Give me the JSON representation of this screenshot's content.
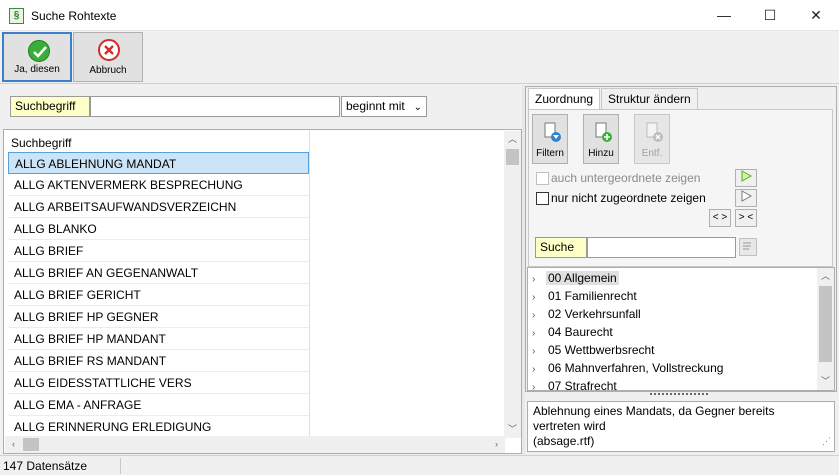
{
  "window": {
    "title": "Suche Rohtexte",
    "icon_glyph": "§",
    "min": "—",
    "max": "☐",
    "close": "✕"
  },
  "toolbar": {
    "ok_label": "Ja, diesen",
    "cancel_label": "Abbruch",
    "ok_color": "#2e9e2e",
    "cancel_color": "#d42a2a"
  },
  "search": {
    "label": "Suchbegriff",
    "value": "",
    "mode": "beginnt mit"
  },
  "list": {
    "header": "Suchbegriff",
    "rows": [
      "ALLG ABLEHNUNG MANDAT",
      "ALLG AKTENVERMERK BESPRECHUNG",
      "ALLG ARBEITSAUFWANDSVERZEICHN",
      "ALLG BLANKO",
      "ALLG BRIEF",
      "ALLG BRIEF AN GEGENANWALT",
      "ALLG BRIEF GERICHT",
      "ALLG BRIEF HP GEGNER",
      "ALLG BRIEF HP MANDANT",
      "ALLG BRIEF RS MANDANT",
      "ALLG EIDESSTATTLICHE VERS",
      "ALLG EMA - ANFRAGE",
      "ALLG ERINNERUNG ERLEDIGUNG"
    ],
    "selected_index": 0
  },
  "tabs": [
    {
      "label": "Zuordnung"
    },
    {
      "label": "Struktur ändern"
    }
  ],
  "assign": {
    "filter_label": "Filtern",
    "add_label": "Hinzu",
    "remove_label": "Entf.",
    "chk_sub": "auch untergeordnete zeigen",
    "chk_unassigned": "nur nicht zugeordnete zeigen",
    "btn_expand": "< >",
    "btn_collapse": "> <",
    "search_label": "Suche",
    "search_value": ""
  },
  "tree": {
    "items": [
      "00 Allgemein",
      "01 Familienrecht",
      "02 Verkehrsunfall",
      "04 Baurecht",
      "05 Wettbwerbsrecht",
      "06 Mahnverfahren, Vollstreckung",
      "07 Strafrecht"
    ],
    "selected_index": 0
  },
  "description": {
    "line1": "Ablehnung eines Mandats, da Gegner bereits",
    "line2": "vertreten wird",
    "line3": "(absage.rtf)"
  },
  "status": {
    "count": "147 Datensätze"
  }
}
